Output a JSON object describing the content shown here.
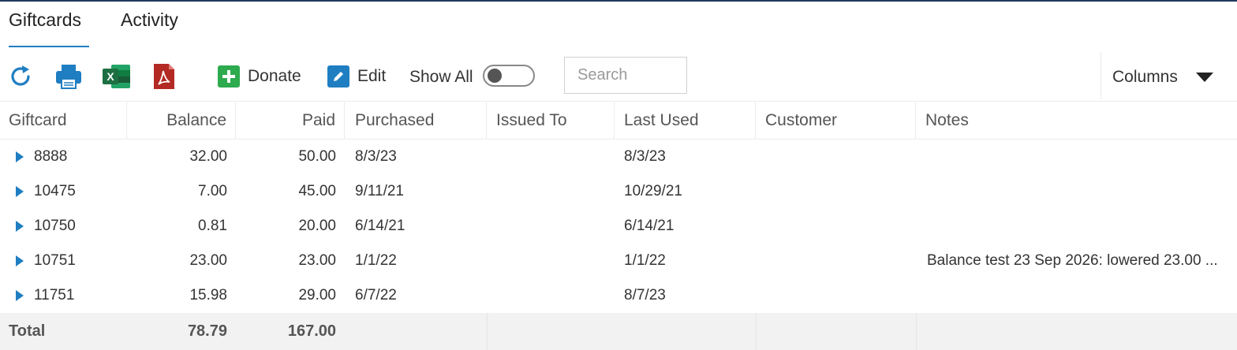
{
  "tabs": [
    {
      "label": "Giftcards",
      "active": true
    },
    {
      "label": "Activity",
      "active": false
    }
  ],
  "toolbar": {
    "icons": [
      "refresh-icon",
      "print-icon",
      "excel-icon",
      "pdf-icon"
    ],
    "donate_label": "Donate",
    "edit_label": "Edit",
    "show_all_label": "Show All",
    "show_all_on": false,
    "search_placeholder": "Search",
    "columns_label": "Columns"
  },
  "colors": {
    "accent": "#1f7ec1",
    "donate_green": "#2eaa4f",
    "edit_blue": "#1f7ec1",
    "excel_green": "#1d6f42",
    "pdf_red": "#b32a24",
    "total_bg": "#f2f2f2"
  },
  "table": {
    "headers": [
      "Giftcard",
      "Balance",
      "Paid",
      "Purchased",
      "Issued To",
      "Last Used",
      "Customer",
      "Notes"
    ],
    "rows": [
      {
        "giftcard": "8888",
        "balance": "32.00",
        "paid": "50.00",
        "purchased": "8/3/23",
        "issued_to": "",
        "last_used": "8/3/23",
        "customer": "",
        "notes": ""
      },
      {
        "giftcard": "10475",
        "balance": "7.00",
        "paid": "45.00",
        "purchased": "9/11/21",
        "issued_to": "",
        "last_used": "10/29/21",
        "customer": "",
        "notes": ""
      },
      {
        "giftcard": "10750",
        "balance": "0.81",
        "paid": "20.00",
        "purchased": "6/14/21",
        "issued_to": "",
        "last_used": "6/14/21",
        "customer": "",
        "notes": ""
      },
      {
        "giftcard": "10751",
        "balance": "23.00",
        "paid": "23.00",
        "purchased": "1/1/22",
        "issued_to": "",
        "last_used": "1/1/22",
        "customer": "",
        "notes": "Balance test 23 Sep 2026: lowered 23.00 ..."
      },
      {
        "giftcard": "11751",
        "balance": "15.98",
        "paid": "29.00",
        "purchased": "6/7/22",
        "issued_to": "",
        "last_used": "8/7/23",
        "customer": "",
        "notes": ""
      }
    ],
    "total": {
      "label": "Total",
      "balance": "78.79",
      "paid": "167.00"
    }
  }
}
